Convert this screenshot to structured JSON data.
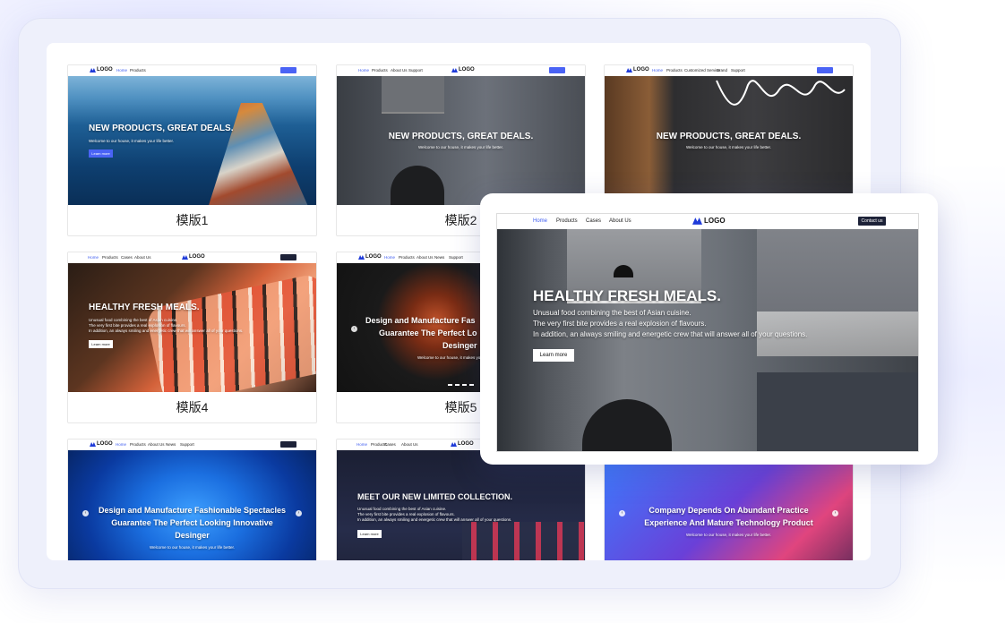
{
  "cards": [
    {
      "label": "模版1",
      "nav": [
        "Home",
        "Products"
      ],
      "cta": "Contact us",
      "title": "NEW PRODUCTS, GREAT DEALS.",
      "subtitle": "Welcome to our house, it makes your life better.",
      "button": "Learn more"
    },
    {
      "label": "模版2",
      "nav": [
        "Home",
        "Products",
        "About Us",
        "Support"
      ],
      "cta": "Contact us",
      "title": "NEW PRODUCTS, GREAT DEALS.",
      "subtitle": "Welcome to our house, it makes your life better."
    },
    {
      "label": "",
      "nav": [
        "Home",
        "Products",
        "Customized Service",
        "Brand",
        "Support"
      ],
      "cta": "Contact us",
      "title": "NEW PRODUCTS, GREAT DEALS.",
      "subtitle": "Welcome to our house, it makes your life better."
    },
    {
      "label": "模版4",
      "nav": [
        "Home",
        "Products",
        "Cases",
        "About Us"
      ],
      "cta": "Contact us",
      "title": "HEALTHY FRESH MEALS.",
      "lines": [
        "Unusual food combining the best of Asian cuisine.",
        "The very first bite provides a real explosion of flavours.",
        "In addition, an always smiling and energetic crew that will answer all of your questions."
      ],
      "button": "Learn more"
    },
    {
      "label": "模版5",
      "nav": [
        "Home",
        "Products",
        "About Us",
        "News",
        "Support"
      ],
      "title_lines": [
        "Design and Manufacture Fas",
        "Guarantee The Perfect Lo",
        "Desinger"
      ],
      "subtitle": "Welcome to our house, it makes yo"
    },
    {
      "label": "",
      "nav": [
        "Home",
        "Products",
        "About Us",
        "News",
        "Support"
      ],
      "cta": "Contact us",
      "title_lines": [
        "Design and Manufacture Fashionable Spectacles",
        "Guarantee The Perfect Looking Innovative",
        "Desinger"
      ],
      "subtitle": "Welcome to our house, it makes your life better."
    },
    {
      "label": "",
      "nav": [
        "Home",
        "Products",
        "Cases",
        "About Us"
      ],
      "title": "MEET OUR NEW LIMITED COLLECTION.",
      "lines": [
        "Unusual food combining the best of Asian cuisine.",
        "The very first bite provides a real explosion of flavours.",
        "In addition, an always smiling and energetic crew that will answer all of your questions."
      ],
      "button": "Learn more"
    },
    {
      "label": "",
      "title_lines": [
        "Company Depends On Abundant Practice",
        "Experience And Mature Technology Product"
      ],
      "subtitle": "Welcome to our house, it makes your life better."
    }
  ],
  "logo_text": "LOGO",
  "preview": {
    "nav": [
      "Home",
      "Products",
      "Cases",
      "About Us"
    ],
    "logo": "LOGO",
    "cta": "Contact us",
    "title": "HEALTHY FRESH MEALS.",
    "lines": [
      "Unusual food combining the best of Asian cuisine.",
      "The very first bite provides a real explosion of flavours.",
      "In addition, an always smiling and energetic crew that will answer all of your questions."
    ],
    "button": "Learn more"
  },
  "colors": {
    "accent": "#4a63f5",
    "dark_button": "#1d2238"
  }
}
